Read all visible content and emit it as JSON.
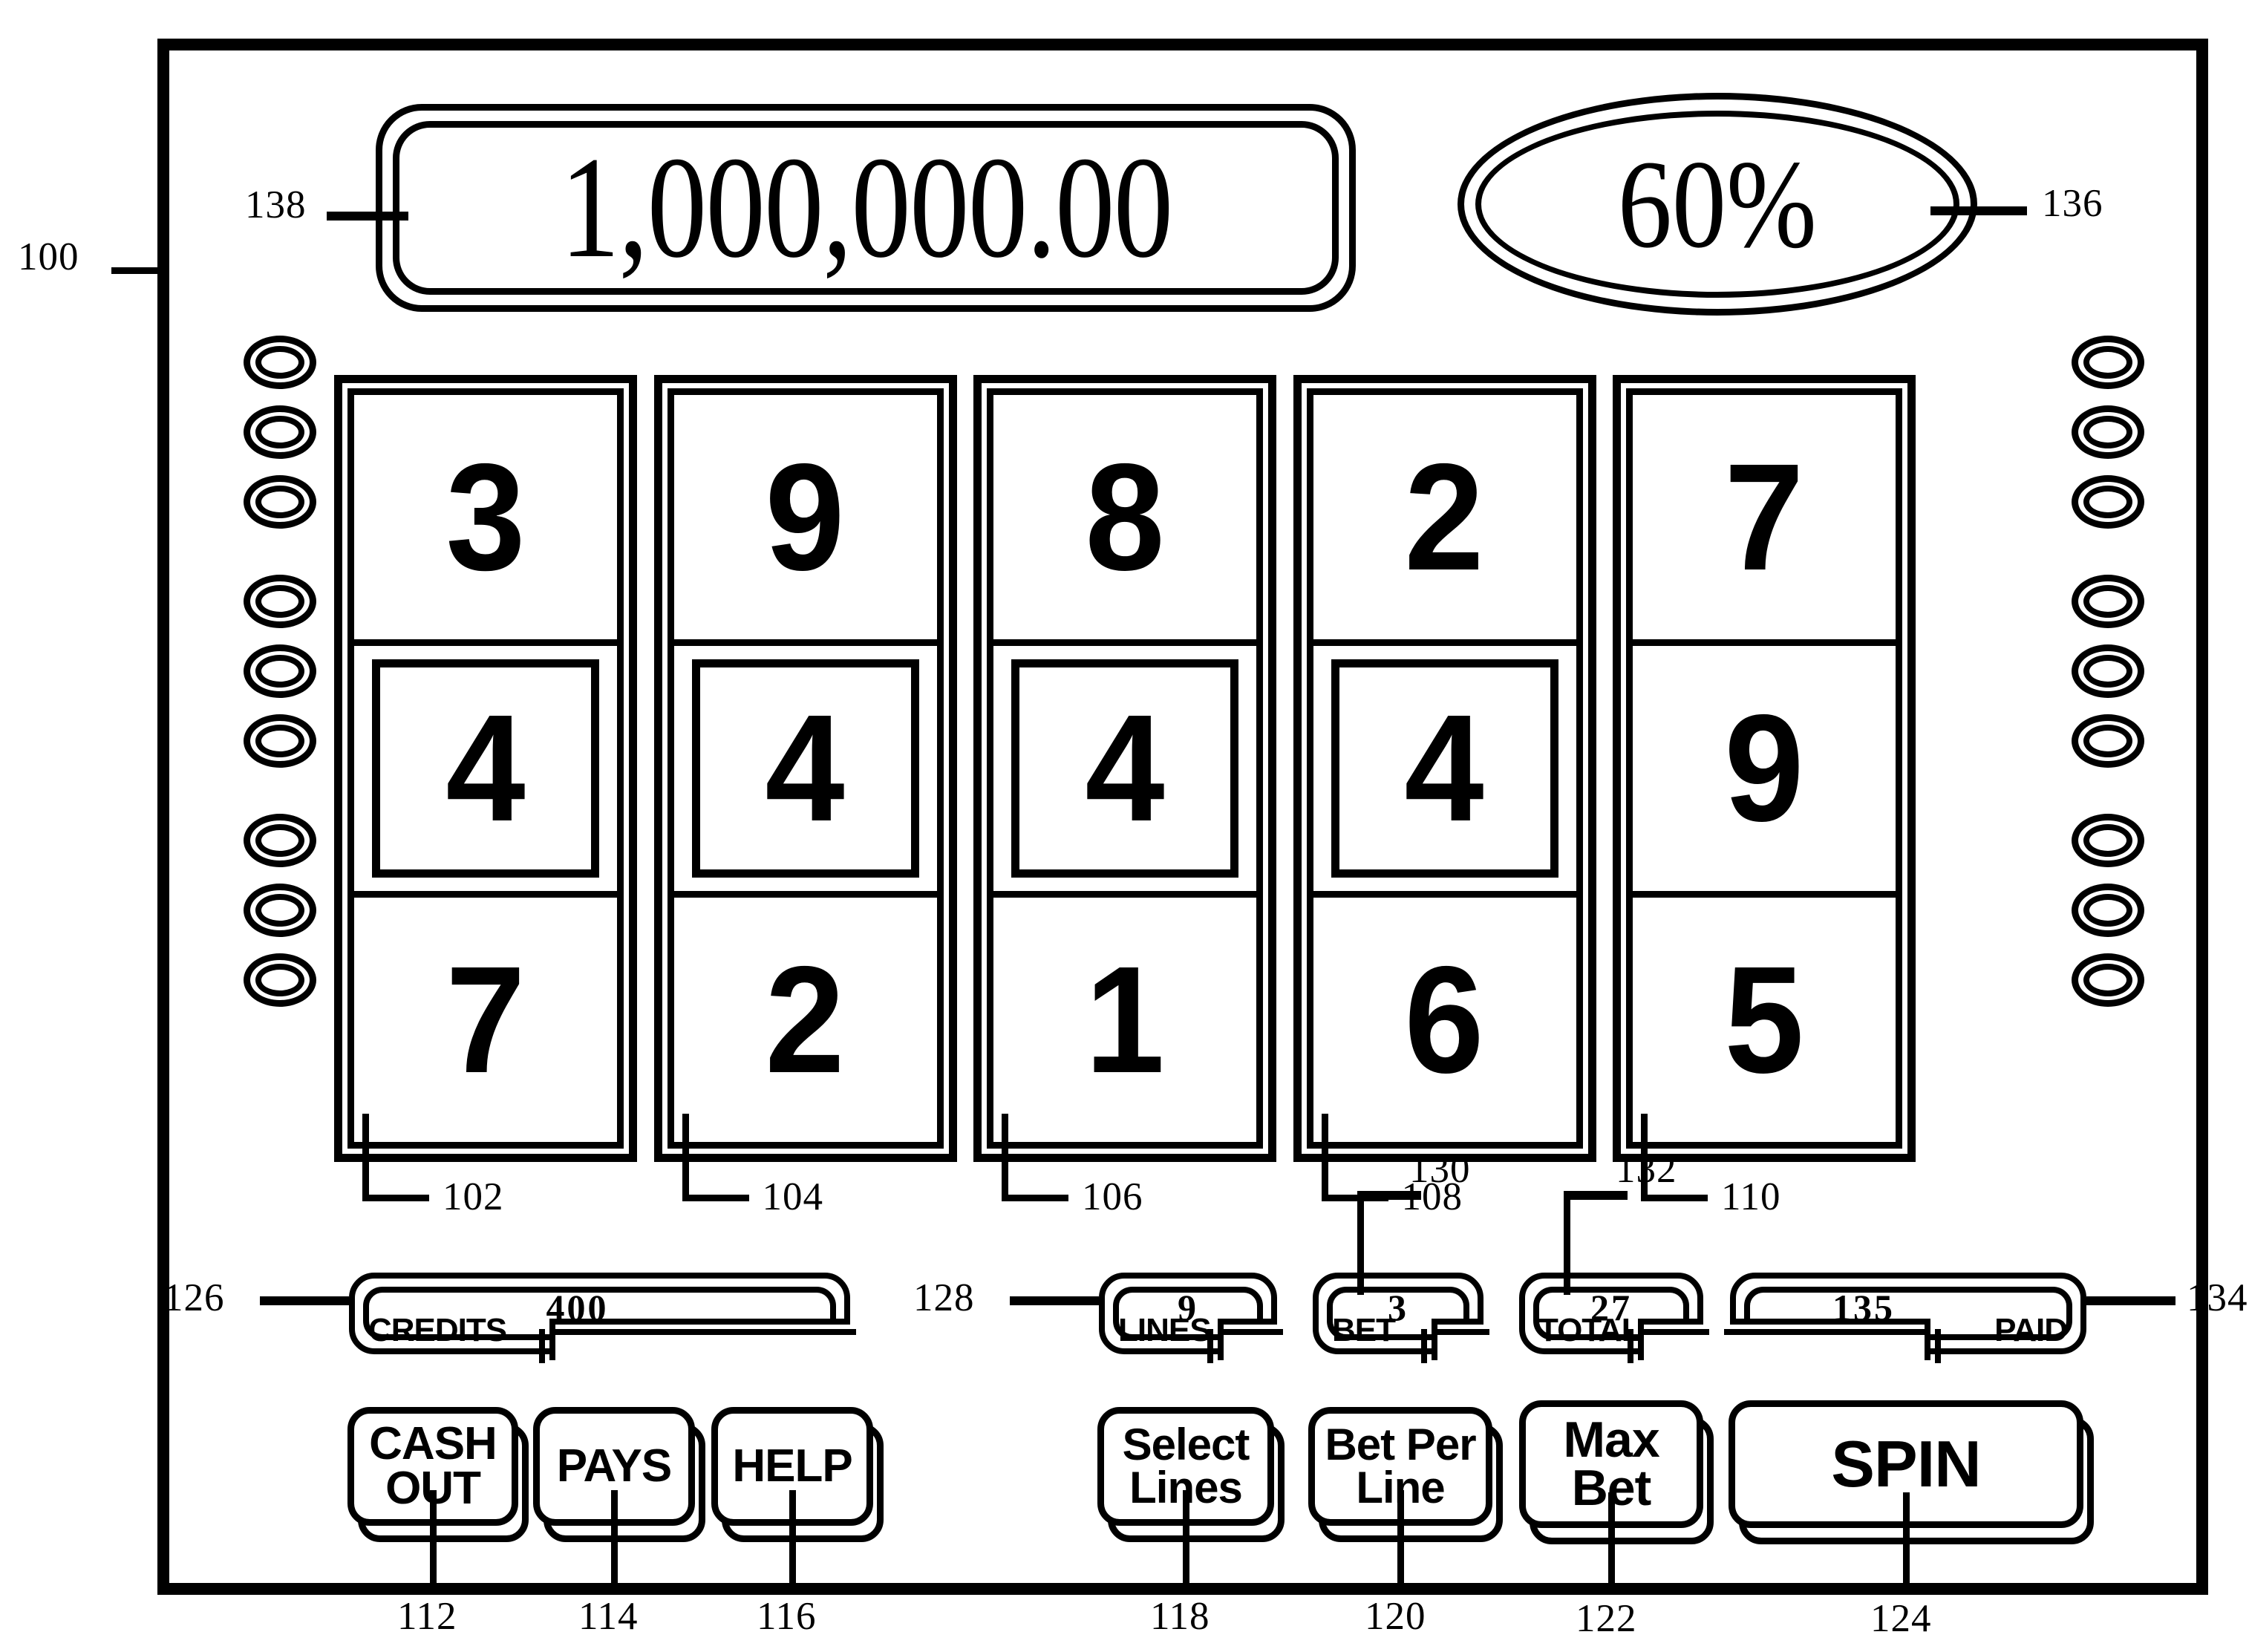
{
  "figure": {
    "kind": "patent-figure",
    "device_label": "100",
    "colors": {
      "ink": "#000000",
      "paper": "#ffffff"
    }
  },
  "top_display": {
    "credit_win_amount": "1,000,000.00",
    "credit_win_ref": "138",
    "percent_value": "60%",
    "percent_ref": "136"
  },
  "reels": [
    {
      "ref": "102",
      "symbols": [
        "3",
        "4",
        "7"
      ],
      "highlight_row": 1
    },
    {
      "ref": "104",
      "symbols": [
        "9",
        "4",
        "2"
      ],
      "highlight_row": 1
    },
    {
      "ref": "106",
      "symbols": [
        "8",
        "4",
        "1"
      ],
      "highlight_row": 1
    },
    {
      "ref": "108",
      "symbols": [
        "2",
        "4",
        "6"
      ],
      "highlight_row": 1
    },
    {
      "ref": "110",
      "symbols": [
        "7",
        "9",
        "5"
      ],
      "highlight_row": -1
    }
  ],
  "lamps": {
    "left_count": 9,
    "right_count": 9,
    "groups": 3,
    "per_group": 3
  },
  "meters": [
    {
      "id": "credits",
      "ref": "126",
      "label": "CREDITS",
      "value": "400",
      "notch": "left"
    },
    {
      "id": "lines",
      "ref": "128",
      "label": "LINES",
      "value": "9",
      "notch": "left"
    },
    {
      "id": "bet",
      "ref": "130",
      "label": "BET",
      "value": "3",
      "notch": "left"
    },
    {
      "id": "total",
      "ref": "132",
      "label": "TOTAL",
      "value": "27",
      "notch": "left"
    },
    {
      "id": "paid",
      "ref": "134",
      "label": "PAID",
      "value": "135",
      "notch": "right"
    }
  ],
  "buttons": [
    {
      "id": "cash-out",
      "ref": "112",
      "lines": [
        "CASH",
        "OUT"
      ]
    },
    {
      "id": "pays",
      "ref": "114",
      "lines": [
        "PAYS"
      ]
    },
    {
      "id": "help",
      "ref": "116",
      "lines": [
        "HELP"
      ]
    },
    {
      "id": "select-lines",
      "ref": "118",
      "lines": [
        "Select",
        "Lines"
      ]
    },
    {
      "id": "bet-per-line",
      "ref": "120",
      "lines": [
        "Bet Per",
        "Line"
      ]
    },
    {
      "id": "max-bet",
      "ref": "122",
      "lines": [
        "Max",
        "Bet"
      ]
    },
    {
      "id": "spin",
      "ref": "124",
      "lines": [
        "SPIN"
      ]
    }
  ]
}
